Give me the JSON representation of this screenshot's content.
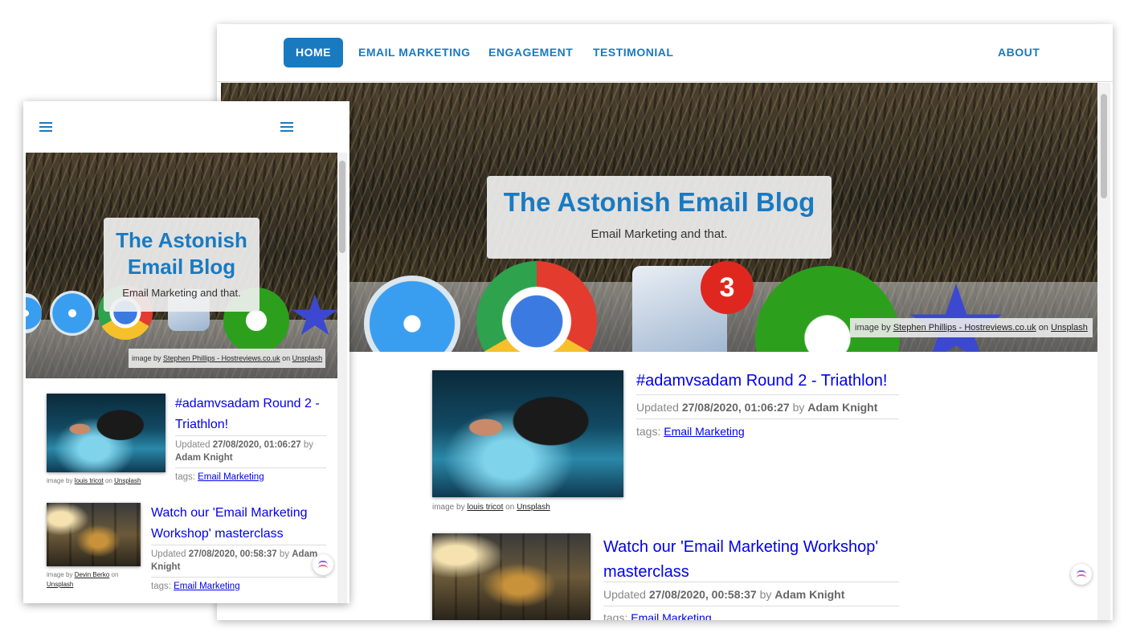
{
  "nav": {
    "home": "HOME",
    "email_marketing": "EMAIL MARKETING",
    "engagement": "ENGAGEMENT",
    "testimonial": "TESTIMONIAL",
    "about": "ABOUT"
  },
  "hero": {
    "title": "The Astonish Email Blog",
    "title_line1": "The Astonish",
    "title_line2": "Email Blog",
    "subtitle": "Email Marketing and that.",
    "badge_count": "3",
    "credit_prefix": "image by",
    "credit_author": "Stephen Phillips - Hostreviews.co.uk",
    "credit_on": "on",
    "credit_source": "Unsplash"
  },
  "posts": [
    {
      "title": "#adamvsadam Round 2 - Triathlon!",
      "title_line1": "#adamvsadam Round 2 -",
      "title_line2": "Triathlon!",
      "updated_label": "Updated",
      "date": "27/08/2020, 01:06:27",
      "by_label": "by",
      "author": "Adam Knight",
      "tags_label": "tags:",
      "tag": "Email Marketing",
      "img_prefix": "image by",
      "img_author": "louis tricot",
      "img_on": "on",
      "img_source": "Unsplash"
    },
    {
      "title": "Watch our 'Email Marketing Workshop' masterclass",
      "title_line1_desktop": "Watch our 'Email Marketing Workshop'",
      "title_line2_desktop": "masterclass",
      "title_line1_mobile": "Watch our 'Email Marketing",
      "title_line2_mobile": "Workshop' masterclass",
      "updated_label": "Updated",
      "date": "27/08/2020, 00:58:37",
      "by_label": "by",
      "author": "Adam Knight",
      "author_first": "Adam",
      "author_last": "Knight",
      "tags_label": "tags:",
      "tag": "Email Marketing",
      "img_prefix": "image by",
      "img_author": "Devin Berko",
      "img_on": "on",
      "img_source": "Unsplash"
    }
  ],
  "colors": {
    "brand": "#1a7ac0",
    "link": "#0000ee",
    "badge": "#e0271f"
  },
  "icons": {
    "menu": "hamburger-menu-icon",
    "widget": "clickup-logo-icon"
  }
}
